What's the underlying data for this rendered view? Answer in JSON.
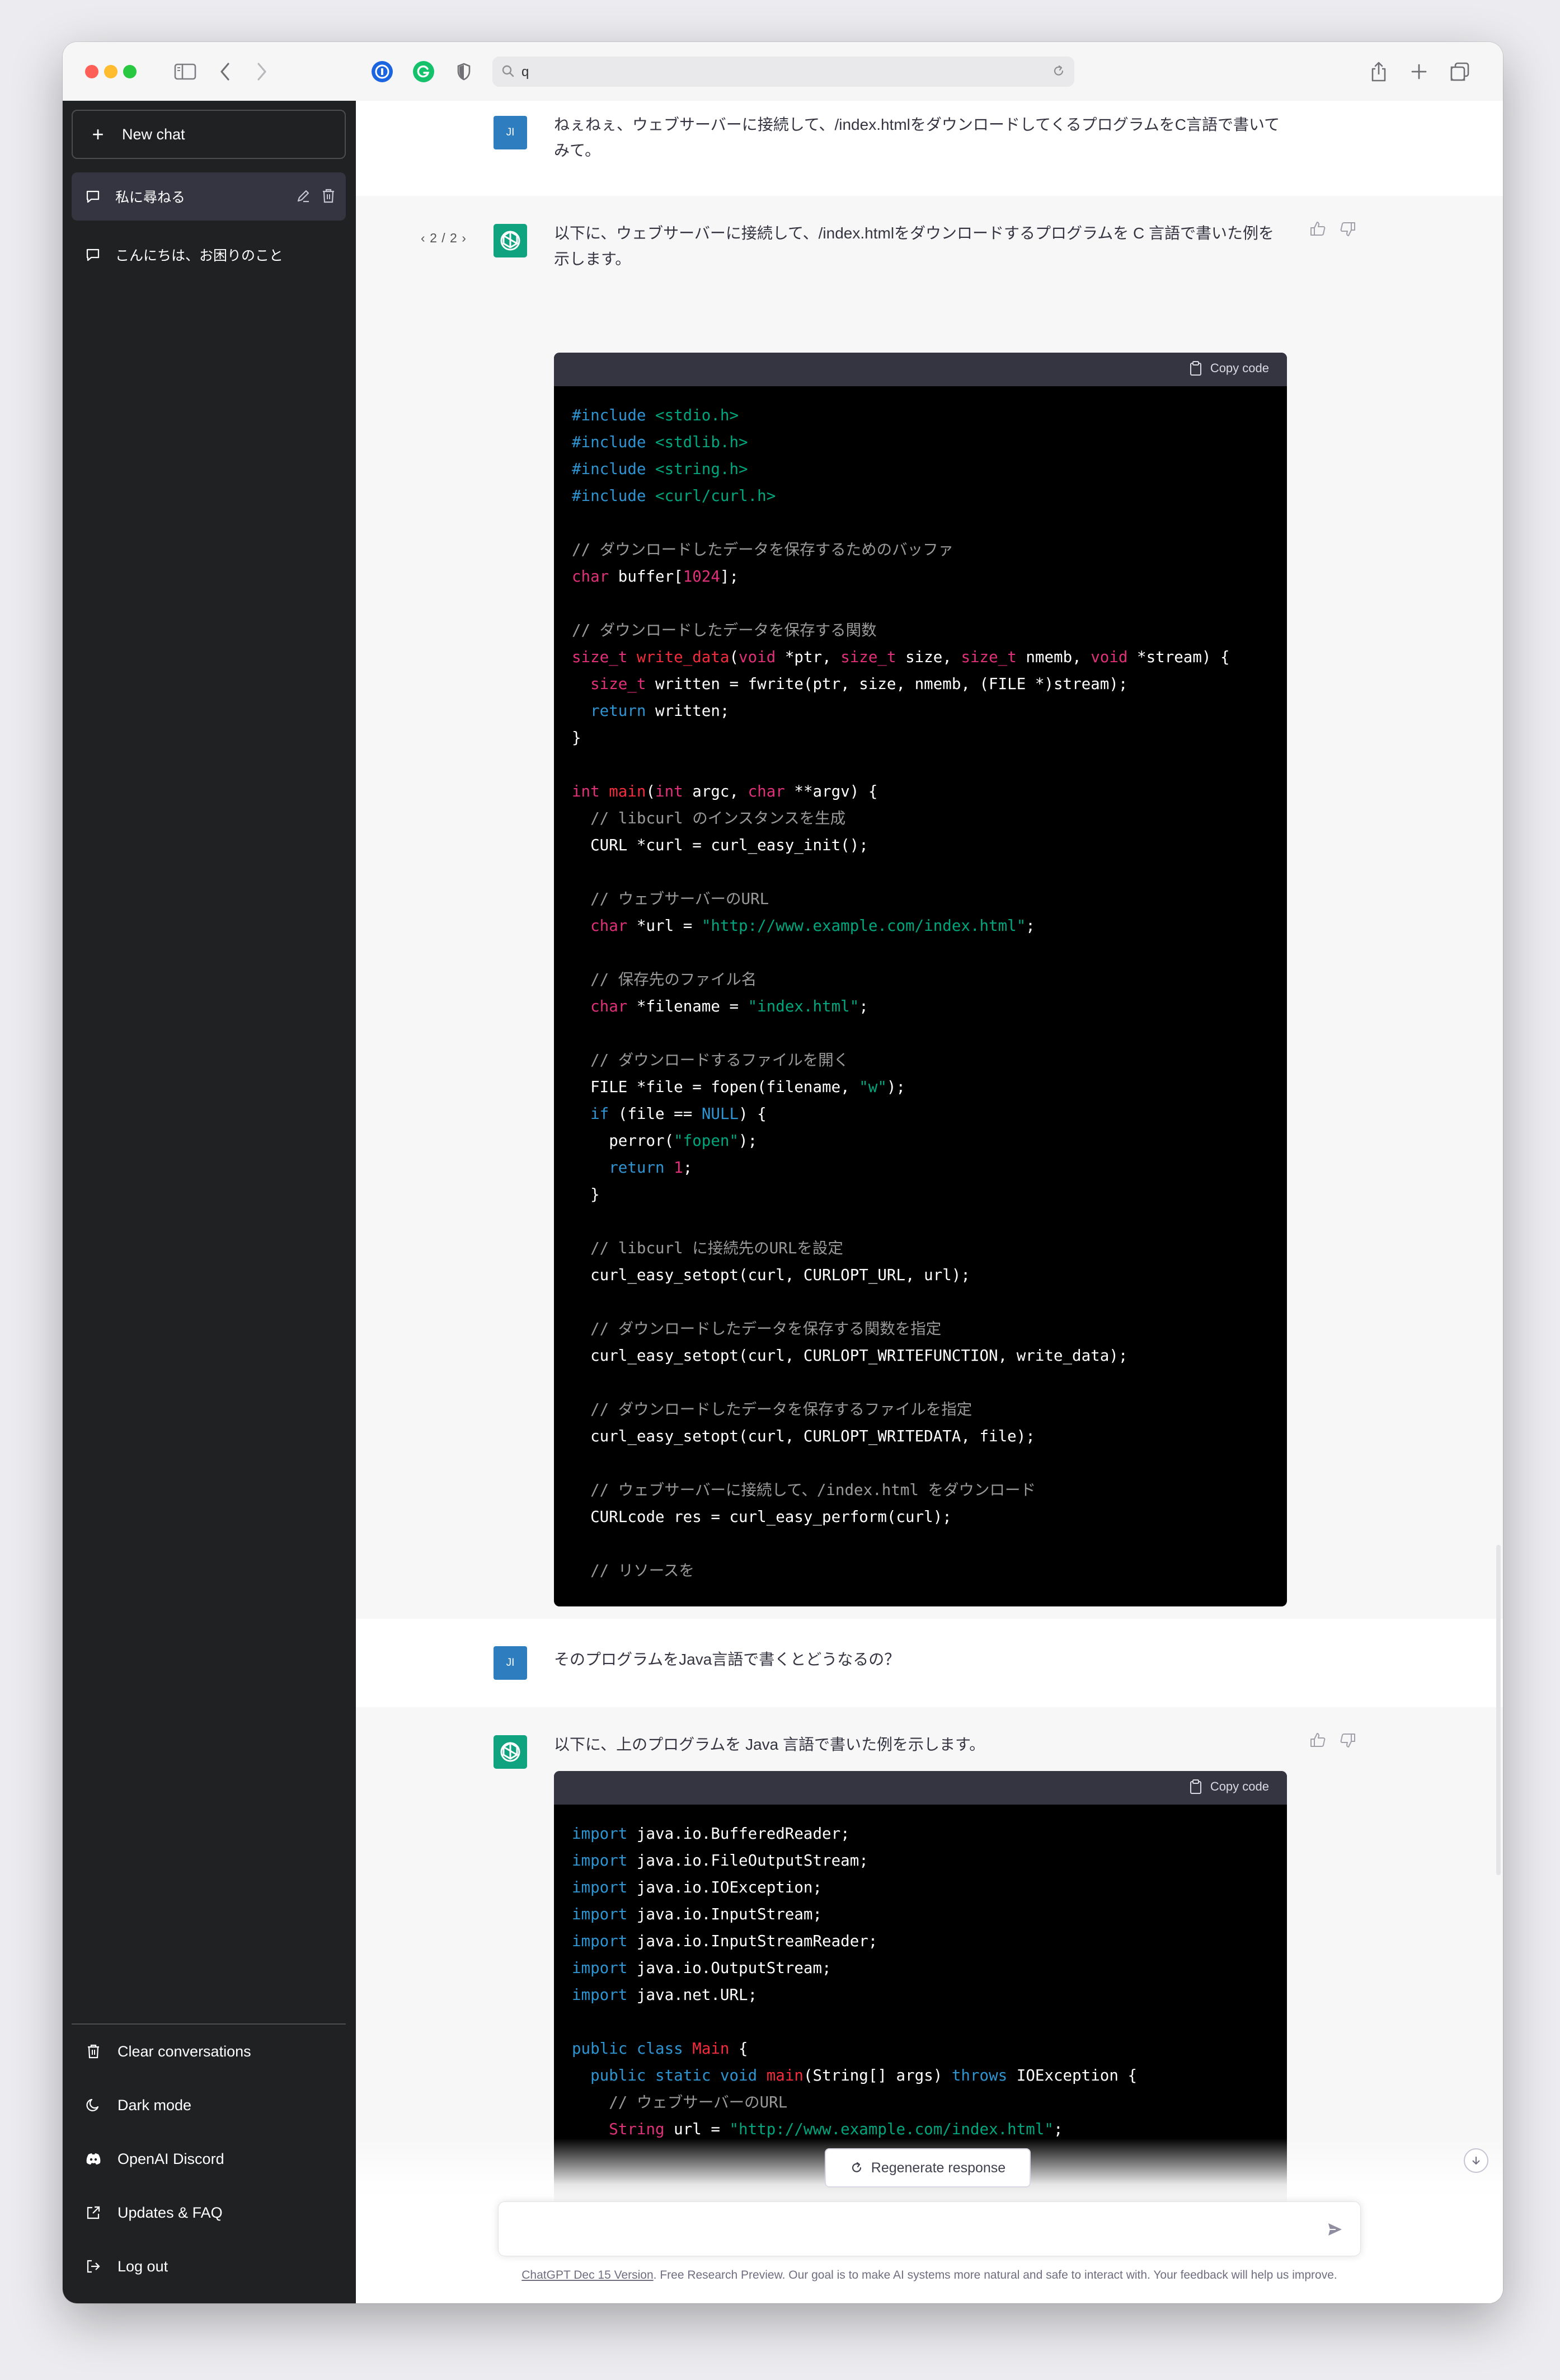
{
  "browser": {
    "address": "q"
  },
  "sidebar": {
    "new_chat": "New chat",
    "conversations": [
      {
        "title": "私に尋ねる"
      },
      {
        "title": "こんにちは、お困りのこと"
      }
    ],
    "menu": [
      {
        "label": "Clear conversations",
        "icon": "trash-icon"
      },
      {
        "label": "Dark mode",
        "icon": "moon-icon"
      },
      {
        "label": "OpenAI Discord",
        "icon": "discord-icon"
      },
      {
        "label": "Updates & FAQ",
        "icon": "external-link-icon"
      },
      {
        "label": "Log out",
        "icon": "logout-icon"
      }
    ]
  },
  "chat": {
    "user_initials": "JI",
    "messages": [
      {
        "role": "user",
        "text": "ねぇねぇ、ウェブサーバーに接続して、/index.htmlをダウンロードしてくるプログラムをC言語で書いてみて。"
      },
      {
        "role": "assistant",
        "pager": "2 / 2",
        "text": "以下に、ウェブサーバーに接続して、/index.htmlをダウンロードするプログラムを C 言語で書いた例を示します。"
      },
      {
        "role": "user",
        "text": "そのプログラムをJava言語で書くとどうなるの？"
      },
      {
        "role": "assistant",
        "text": "以下に、上のプログラムを Java 言語で書いた例を示します。"
      }
    ],
    "copy_code": "Copy code"
  },
  "composer": {
    "regenerate": "Regenerate response",
    "placeholder": ""
  },
  "footer": {
    "version_link": "ChatGPT Dec 15 Version",
    "text": ". Free Research Preview. Our goal is to make AI systems more natural and safe to interact with. Your feedback will help us improve."
  },
  "colors": {
    "sidebar_bg": "#202123",
    "assistant_bg": "#f7f7f8",
    "brand_green": "#10a37f",
    "user_avatar": "#2e7dbf",
    "code_keyword": "#2e95d3",
    "code_type": "#df3079",
    "code_string": "#00a67d"
  },
  "code_c": [
    [
      [
        "kw",
        "#include "
      ],
      [
        "str",
        "<stdio.h>"
      ]
    ],
    [
      [
        "kw",
        "#include "
      ],
      [
        "str",
        "<stdlib.h>"
      ]
    ],
    [
      [
        "kw",
        "#include "
      ],
      [
        "str",
        "<string.h>"
      ]
    ],
    [
      [
        "kw",
        "#include "
      ],
      [
        "str",
        "<curl/curl.h>"
      ]
    ],
    [],
    [
      [
        "cm",
        "// ダウンロードしたデータを保存するためのバッファ"
      ]
    ],
    [
      [
        "ty",
        "char"
      ],
      [
        "p",
        " buffer["
      ],
      [
        "num",
        "1024"
      ],
      [
        "p",
        "];"
      ]
    ],
    [],
    [
      [
        "cm",
        "// ダウンロードしたデータを保存する関数"
      ]
    ],
    [
      [
        "ty",
        "size_t"
      ],
      [
        "p",
        " "
      ],
      [
        "fn",
        "write_data"
      ],
      [
        "p",
        "("
      ],
      [
        "ty",
        "void"
      ],
      [
        "p",
        " *ptr, "
      ],
      [
        "ty",
        "size_t"
      ],
      [
        "p",
        " size, "
      ],
      [
        "ty",
        "size_t"
      ],
      [
        "p",
        " nmemb, "
      ],
      [
        "ty",
        "void"
      ],
      [
        "p",
        " *stream) {"
      ]
    ],
    [
      [
        "p",
        "  "
      ],
      [
        "ty",
        "size_t"
      ],
      [
        "p",
        " written = fwrite(ptr, size, nmemb, (FILE *)stream);"
      ]
    ],
    [
      [
        "p",
        "  "
      ],
      [
        "kw",
        "return"
      ],
      [
        "p",
        " written;"
      ]
    ],
    [
      [
        "p",
        "}"
      ]
    ],
    [],
    [
      [
        "ty",
        "int"
      ],
      [
        "p",
        " "
      ],
      [
        "fn",
        "main"
      ],
      [
        "p",
        "("
      ],
      [
        "ty",
        "int"
      ],
      [
        "p",
        " argc, "
      ],
      [
        "ty",
        "char"
      ],
      [
        "p",
        " **argv) {"
      ]
    ],
    [
      [
        "p",
        "  "
      ],
      [
        "cm",
        "// libcurl のインスタンスを生成"
      ]
    ],
    [
      [
        "p",
        "  CURL *curl = curl_easy_init();"
      ]
    ],
    [],
    [
      [
        "p",
        "  "
      ],
      [
        "cm",
        "// ウェブサーバーのURL"
      ]
    ],
    [
      [
        "p",
        "  "
      ],
      [
        "ty",
        "char"
      ],
      [
        "p",
        " *url = "
      ],
      [
        "str",
        "\"http://www.example.com/index.html\""
      ],
      [
        "p",
        ";"
      ]
    ],
    [],
    [
      [
        "p",
        "  "
      ],
      [
        "cm",
        "// 保存先のファイル名"
      ]
    ],
    [
      [
        "p",
        "  "
      ],
      [
        "ty",
        "char"
      ],
      [
        "p",
        " *filename = "
      ],
      [
        "str",
        "\"index.html\""
      ],
      [
        "p",
        ";"
      ]
    ],
    [],
    [
      [
        "p",
        "  "
      ],
      [
        "cm",
        "// ダウンロードするファイルを開く"
      ]
    ],
    [
      [
        "p",
        "  FILE *file = fopen(filename, "
      ],
      [
        "str",
        "\"w\""
      ],
      [
        "p",
        ");"
      ]
    ],
    [
      [
        "p",
        "  "
      ],
      [
        "kw",
        "if"
      ],
      [
        "p",
        " (file == "
      ],
      [
        "kw",
        "NULL"
      ],
      [
        "p",
        ") {"
      ]
    ],
    [
      [
        "p",
        "    perror("
      ],
      [
        "str",
        "\"fopen\""
      ],
      [
        "p",
        ");"
      ]
    ],
    [
      [
        "p",
        "    "
      ],
      [
        "kw",
        "return"
      ],
      [
        "p",
        " "
      ],
      [
        "num",
        "1"
      ],
      [
        "p",
        ";"
      ]
    ],
    [
      [
        "p",
        "  }"
      ]
    ],
    [],
    [
      [
        "p",
        "  "
      ],
      [
        "cm",
        "// libcurl に接続先のURLを設定"
      ]
    ],
    [
      [
        "p",
        "  curl_easy_setopt(curl, CURLOPT_URL, url);"
      ]
    ],
    [],
    [
      [
        "p",
        "  "
      ],
      [
        "cm",
        "// ダウンロードしたデータを保存する関数を指定"
      ]
    ],
    [
      [
        "p",
        "  curl_easy_setopt(curl, CURLOPT_WRITEFUNCTION, write_data);"
      ]
    ],
    [],
    [
      [
        "p",
        "  "
      ],
      [
        "cm",
        "// ダウンロードしたデータを保存するファイルを指定"
      ]
    ],
    [
      [
        "p",
        "  curl_easy_setopt(curl, CURLOPT_WRITEDATA, file);"
      ]
    ],
    [],
    [
      [
        "p",
        "  "
      ],
      [
        "cm",
        "// ウェブサーバーに接続して、/index.html をダウンロード"
      ]
    ],
    [
      [
        "p",
        "  CURLcode res = curl_easy_perform(curl);"
      ]
    ],
    [],
    [
      [
        "p",
        "  "
      ],
      [
        "cm",
        "// リソースを"
      ]
    ]
  ],
  "code_java": [
    [
      [
        "kw",
        "import"
      ],
      [
        "p",
        " java.io.BufferedReader;"
      ]
    ],
    [
      [
        "kw",
        "import"
      ],
      [
        "p",
        " java.io.FileOutputStream;"
      ]
    ],
    [
      [
        "kw",
        "import"
      ],
      [
        "p",
        " java.io.IOException;"
      ]
    ],
    [
      [
        "kw",
        "import"
      ],
      [
        "p",
        " java.io.InputStream;"
      ]
    ],
    [
      [
        "kw",
        "import"
      ],
      [
        "p",
        " java.io.InputStreamReader;"
      ]
    ],
    [
      [
        "kw",
        "import"
      ],
      [
        "p",
        " java.io.OutputStream;"
      ]
    ],
    [
      [
        "kw",
        "import"
      ],
      [
        "p",
        " java.net.URL;"
      ]
    ],
    [],
    [
      [
        "kw",
        "public"
      ],
      [
        "p",
        " "
      ],
      [
        "kw",
        "class"
      ],
      [
        "p",
        " "
      ],
      [
        "fn",
        "Main"
      ],
      [
        "p",
        " {"
      ]
    ],
    [
      [
        "p",
        "  "
      ],
      [
        "kw",
        "public"
      ],
      [
        "p",
        " "
      ],
      [
        "kw",
        "static"
      ],
      [
        "p",
        " "
      ],
      [
        "kw",
        "void"
      ],
      [
        "p",
        " "
      ],
      [
        "fn",
        "main"
      ],
      [
        "p",
        "(String[] args) "
      ],
      [
        "kw",
        "throws"
      ],
      [
        "p",
        " IOException {"
      ]
    ],
    [
      [
        "p",
        "    "
      ],
      [
        "cm",
        "// ウェブサーバーのURL"
      ]
    ],
    [
      [
        "p",
        "    "
      ],
      [
        "ty",
        "String"
      ],
      [
        "p",
        " url = "
      ],
      [
        "str",
        "\"http://www.example.com/index.html\""
      ],
      [
        "p",
        ";"
      ]
    ]
  ]
}
